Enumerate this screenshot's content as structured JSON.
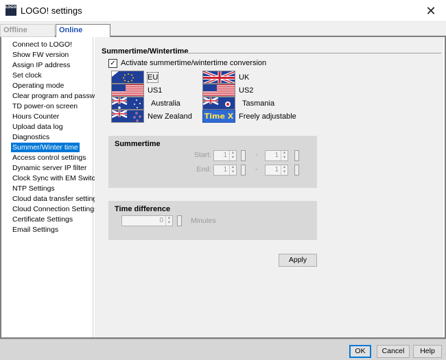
{
  "window": {
    "title": "LOGO! settings",
    "app_icon_text": "LOGO!",
    "close_glyph": "✕"
  },
  "tabs": [
    {
      "label": "Offline settings"
    },
    {
      "label": "Online settings"
    }
  ],
  "sidebar": {
    "items": [
      {
        "label": "Connect to LOGO!"
      },
      {
        "label": "Show FW version"
      },
      {
        "label": "Assign IP address"
      },
      {
        "label": "Set clock"
      },
      {
        "label": "Operating mode"
      },
      {
        "label": "Clear program and password"
      },
      {
        "label": "TD power-on screen"
      },
      {
        "label": "Hours Counter"
      },
      {
        "label": "Upload data log"
      },
      {
        "label": "Diagnostics"
      },
      {
        "label": "Summer/Winter time"
      },
      {
        "label": "Access control settings"
      },
      {
        "label": "Dynamic server IP filter"
      },
      {
        "label": "Clock Sync with EM Switch"
      },
      {
        "label": "NTP Settings"
      },
      {
        "label": "Cloud data transfer settings"
      },
      {
        "label": "Cloud Connection Settings"
      },
      {
        "label": "Certificate Settings"
      },
      {
        "label": "Email Settings"
      }
    ],
    "selected": "Summer/Winter time"
  },
  "main": {
    "section_title": "Summertime/Wintertime",
    "activate_label": "Activate summertime/wintertime conversion",
    "activate_checked": true,
    "check_glyph": "✓",
    "regions": [
      {
        "label": "EU",
        "flag": "eu-flag-icon",
        "selected": true
      },
      {
        "label": "UK",
        "flag": "uk-flag-icon"
      },
      {
        "label": "US1",
        "flag": "us-flag-icon"
      },
      {
        "label": "US2",
        "flag": "us-flag-icon"
      },
      {
        "label": "Australia",
        "flag": "australia-flag-icon"
      },
      {
        "label": "Tasmania",
        "flag": "tasmania-flag-icon"
      },
      {
        "label": "New Zealand",
        "flag": "new-zealand-flag-icon"
      },
      {
        "label": "Freely adjustable",
        "flag": "time-x-icon",
        "badge": "Time X"
      }
    ],
    "summertime": {
      "title": "Summertime",
      "start_label": "Start:",
      "end_label": "End:",
      "start_values": [
        "1",
        "1"
      ],
      "end_values": [
        "1",
        "1"
      ],
      "separator": "-"
    },
    "time_difference": {
      "title": "Time difference",
      "value": "0",
      "unit": "Minutes"
    },
    "apply_label": "Apply"
  },
  "footer": {
    "ok_label": "OK",
    "cancel_label": "Cancel",
    "help_label": "Help"
  },
  "colors": {
    "selection": "#0078d7",
    "online_tab": "#1e50b4",
    "footer": "#d6d6d6",
    "content_bg": "#f0f0f0",
    "groupbox_bg": "#d8d8d8"
  }
}
